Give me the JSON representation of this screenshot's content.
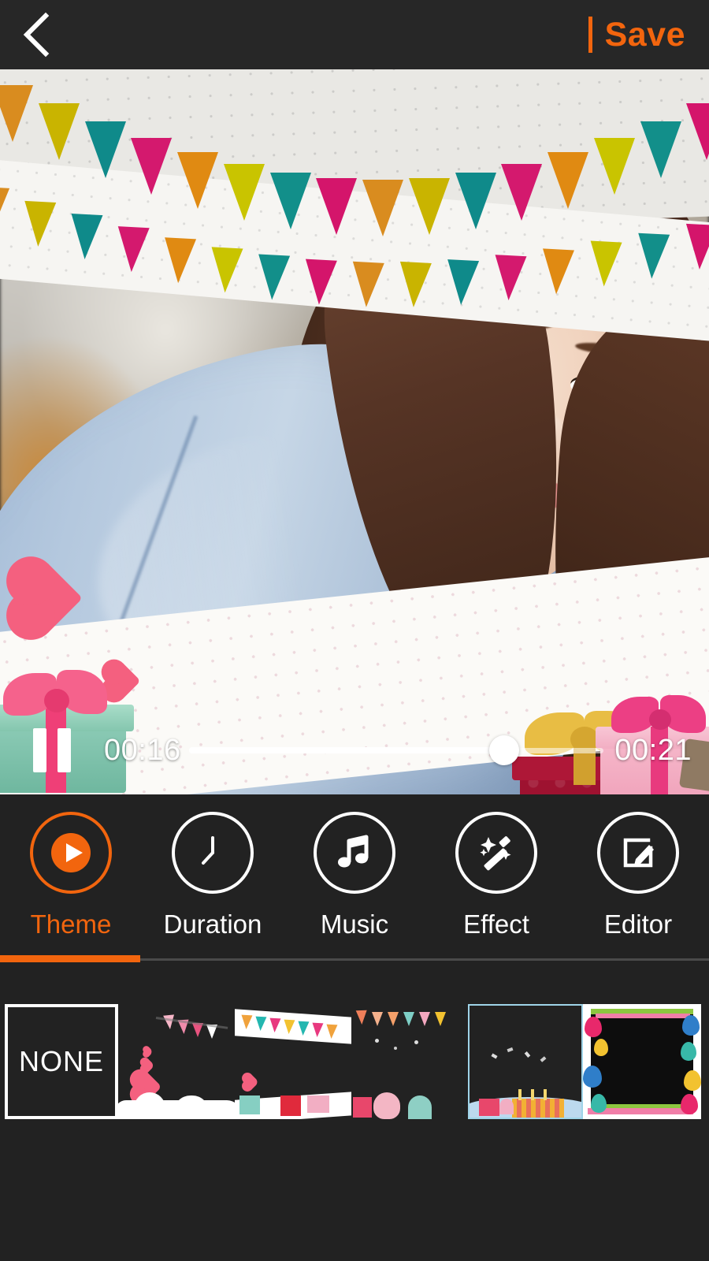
{
  "app": {
    "screen_name": "video-editor-theme",
    "background_color": "#222222",
    "accent_color": "#F2650E"
  },
  "topbar": {
    "back_icon": "chevron-left-icon",
    "save_label": "Save",
    "divider_color": "#F2650E",
    "save_color": "#F2650E",
    "background_color": "#272727"
  },
  "preview": {
    "description": "Video preview of a young woman with long brown hair wearing a fur hat and light blue denim shirt, decorated with a party bunting theme overlay",
    "overlay_theme": "birthday-party-bunting",
    "decorations": [
      "bunting-flags",
      "pink-hearts",
      "mint-gift-box",
      "red-gift-box",
      "pink-gift-box"
    ]
  },
  "player": {
    "state": "playing",
    "pause_icon": "pause-icon",
    "current_time": "00:16",
    "total_time": "00:21",
    "progress_percent": 76,
    "track_color": "#FFFFFF",
    "thumb_color": "#FFFFFF"
  },
  "tabs": [
    {
      "label": "Theme",
      "icon": "play-circle-icon",
      "active": true
    },
    {
      "label": "Duration",
      "icon": "clock-icon",
      "active": false
    },
    {
      "label": "Music",
      "icon": "music-note-icon",
      "active": false
    },
    {
      "label": "Effect",
      "icon": "magic-wand-icon",
      "active": false
    },
    {
      "label": "Editor",
      "icon": "pencil-square-icon",
      "active": false
    }
  ],
  "themes": [
    {
      "id": "none",
      "label": "NONE",
      "selected": true,
      "kind": "none"
    },
    {
      "id": "love",
      "label": "",
      "selected": false,
      "kind": "pink-bunting-hearts"
    },
    {
      "id": "party",
      "label": "",
      "selected": false,
      "kind": "colorful-bunting-gifts"
    },
    {
      "id": "confetti",
      "label": "",
      "selected": false,
      "kind": "confetti-cupcake"
    },
    {
      "id": "cake",
      "label": "",
      "selected": false,
      "kind": "birthday-cake-frame"
    },
    {
      "id": "balloons",
      "label": "",
      "selected": false,
      "kind": "balloon-frame"
    }
  ]
}
